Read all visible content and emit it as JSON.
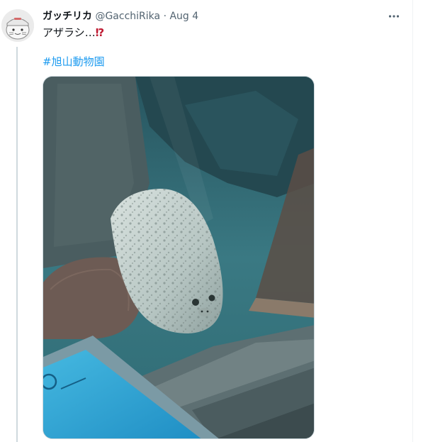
{
  "tweet": {
    "display_name": "ガッチリカ",
    "handle": "@GacchiRika",
    "separator": "·",
    "date": "Aug 4",
    "text": "アザラシ…",
    "emoji": "⁉",
    "hashtag": "#旭山動物園"
  },
  "icons": {
    "more": "more-options-icon",
    "avatar": "user-avatar",
    "emoji": "exclamation-question-emoji"
  },
  "colors": {
    "link": "#1d9bf0",
    "secondary_text": "#536471",
    "thread_line": "#cfd9de",
    "emoji_red": "#be1931"
  }
}
